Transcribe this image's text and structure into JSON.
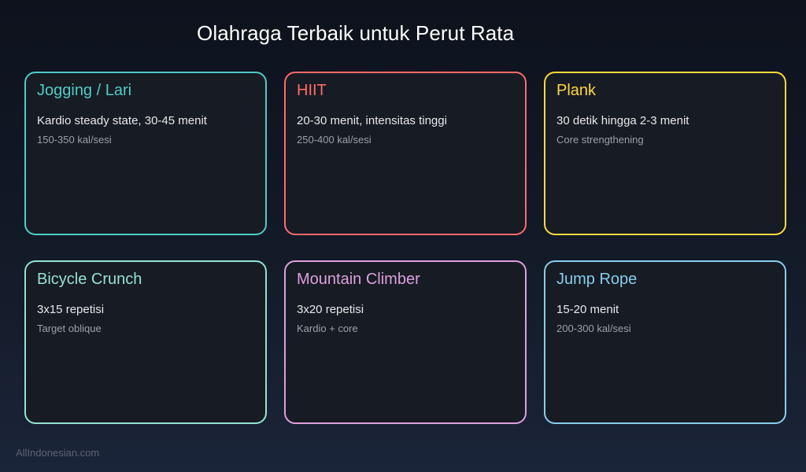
{
  "header": {
    "title": "Olahraga Terbaik untuk Perut Rata"
  },
  "cards": [
    {
      "title": "Jogging / Lari",
      "detail": "Kardio steady state, 30-45 menit",
      "meta": "150-350 kal/sesi",
      "color": "#4ecdc4"
    },
    {
      "title": "HIIT",
      "detail": "20-30 menit, intensitas tinggi",
      "meta": "250-400 kal/sesi",
      "color": "#ff6b6b"
    },
    {
      "title": "Plank",
      "detail": "30 detik hingga 2-3 menit",
      "meta": "Core strengthening",
      "color": "#ffd93d"
    },
    {
      "title": "Bicycle Crunch",
      "detail": "3x15 repetisi",
      "meta": "Target oblique",
      "color": "#95e1d3"
    },
    {
      "title": "Mountain Climber",
      "detail": "3x20 repetisi",
      "meta": "Kardio + core",
      "color": "#dda0dd"
    },
    {
      "title": "Jump Rope",
      "detail": "15-20 menit",
      "meta": "200-300 kal/sesi",
      "color": "#87ceeb"
    }
  ],
  "footer": {
    "source": "AllIndonesian.com"
  }
}
